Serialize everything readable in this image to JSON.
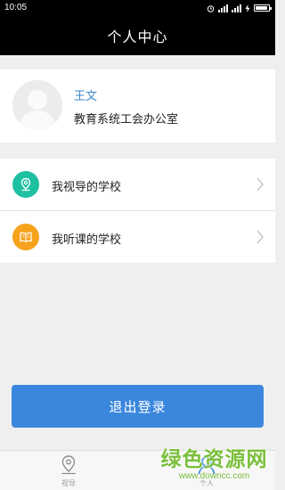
{
  "status_bar": {
    "time": "10:05",
    "battery_level": 0.9
  },
  "header": {
    "title": "个人中心"
  },
  "profile": {
    "name": "王文",
    "org": "教育系统工会办公室"
  },
  "menu": {
    "items": [
      {
        "label": "我视导的学校",
        "icon": "location-pin-icon",
        "color": "#1ec0a0"
      },
      {
        "label": "我听课的学校",
        "icon": "open-book-icon",
        "color": "#f7a21b"
      }
    ]
  },
  "logout": {
    "label": "退出登录",
    "color": "#3b87de"
  },
  "tabbar": {
    "tabs": [
      {
        "label": "视导",
        "icon": "location-pin-icon",
        "active": false
      },
      {
        "label": "个人",
        "icon": "person-icon",
        "active": true
      }
    ]
  },
  "watermark": {
    "title": "绿色资源网",
    "url": "www.downcc.com"
  }
}
